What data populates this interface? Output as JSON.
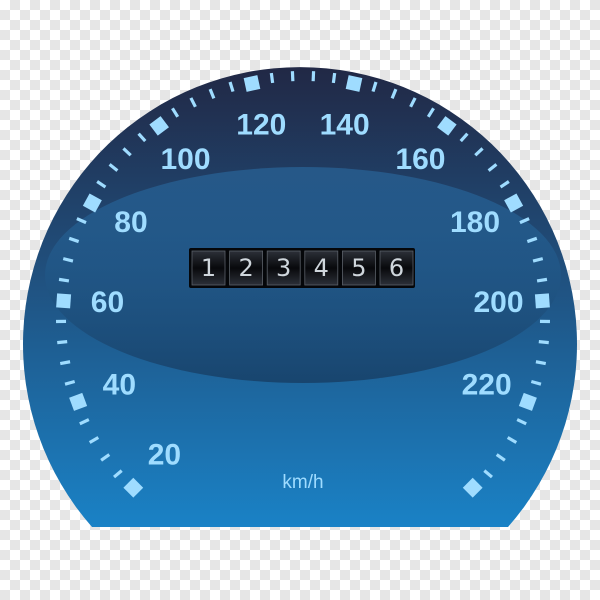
{
  "gauge": {
    "unit": "km/h",
    "scale_labels": [
      "20",
      "40",
      "60",
      "80",
      "100",
      "120",
      "140",
      "160",
      "180",
      "200",
      "220"
    ],
    "odometer_digits": [
      "1",
      "2",
      "3",
      "4",
      "5",
      "6"
    ],
    "colors": {
      "dial_top": "#1f2a4a",
      "dial_bottom": "#1c7ec0",
      "tick": "#9fdcff",
      "label": "#9fdcff",
      "odometer_bg": "#0d0f14"
    }
  }
}
